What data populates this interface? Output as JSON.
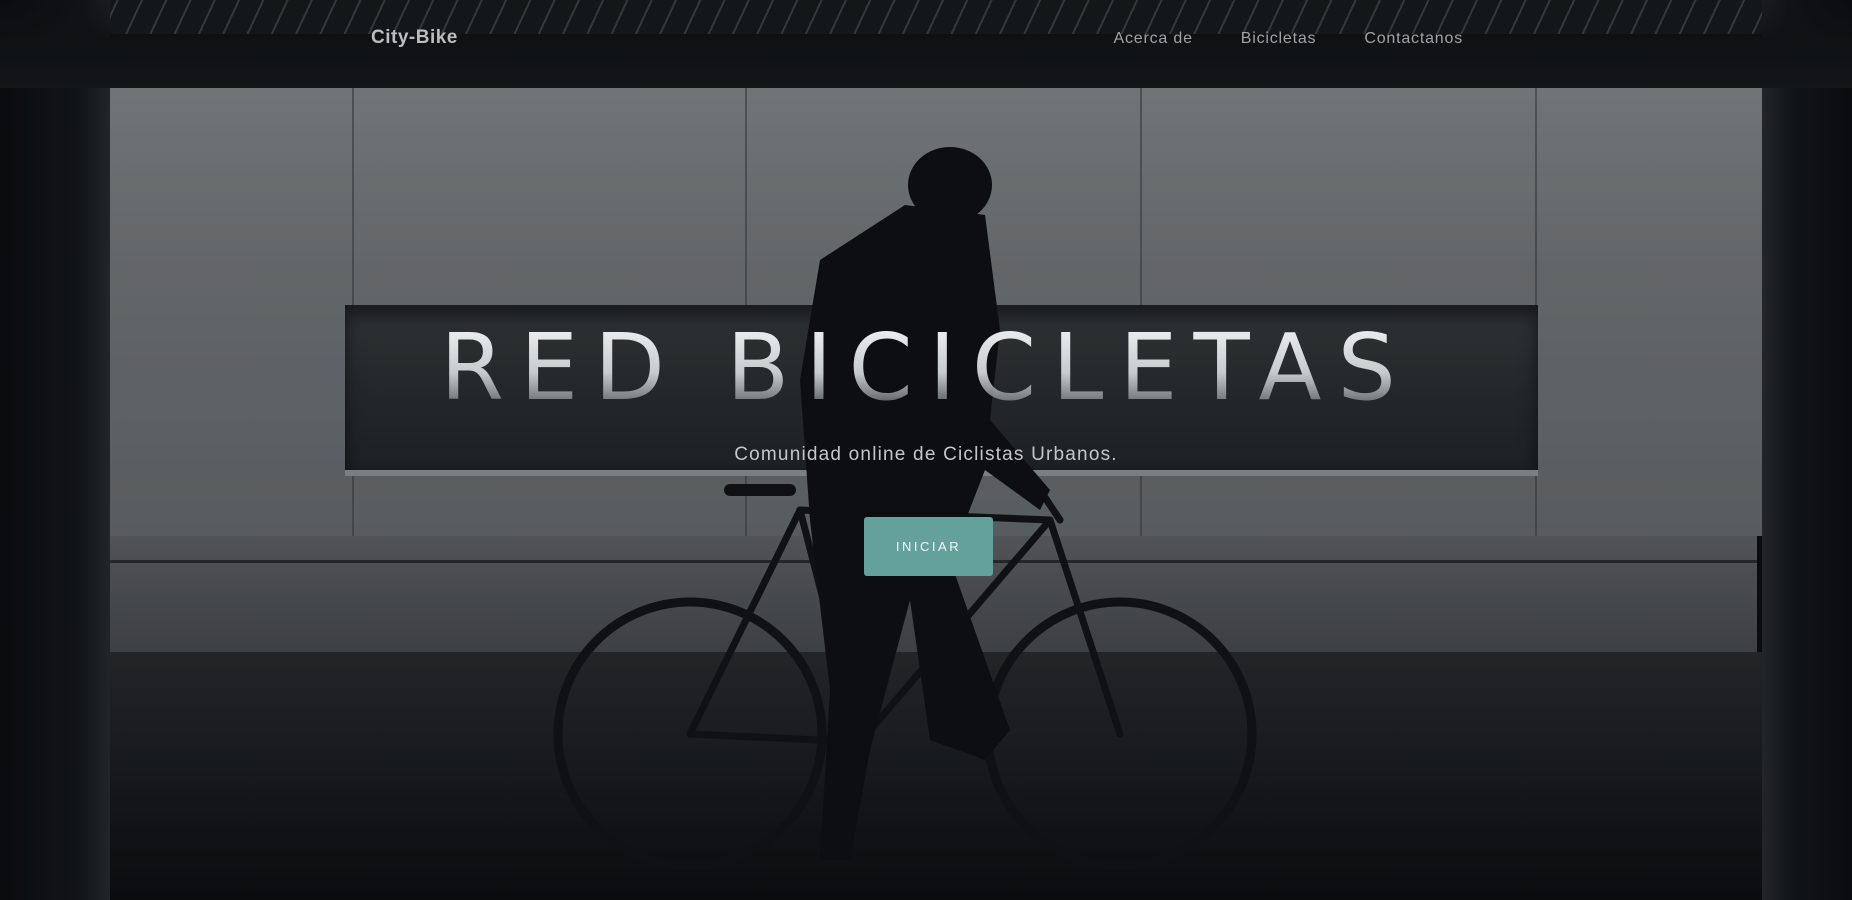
{
  "nav": {
    "brand": "City-Bike",
    "links": [
      "Acerca de",
      "Bicicletas",
      "Contactanos"
    ]
  },
  "hero": {
    "title": "RED BICICLETAS",
    "subtitle": "Comunidad online de Ciclistas Urbanos.",
    "cta_label": "INICIAR"
  },
  "colors": {
    "accent": "#64a19b",
    "background": "#0b0d0e",
    "text": "#c9cdd0"
  },
  "background_image": "silhouette of a cyclist on a bicycle in a concrete underpass"
}
